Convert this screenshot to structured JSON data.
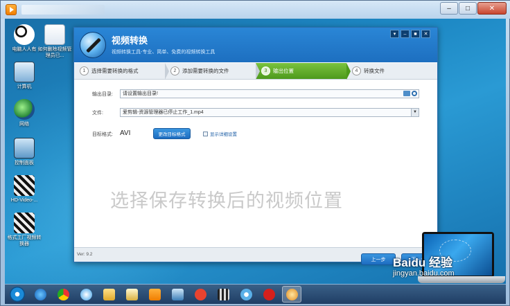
{
  "desktop_icons": [
    {
      "label": "电脑人人有",
      "glyph": "panda-icon"
    },
    {
      "label": "如何删除视频管理员已...",
      "glyph": "document-icon"
    },
    {
      "label": "计算机",
      "glyph": "computer-icon"
    },
    {
      "label": "网络",
      "glyph": "network-icon"
    },
    {
      "label": "控制面板",
      "glyph": "control-panel-icon"
    },
    {
      "label": "HD-Video-...",
      "glyph": "clapper-icon"
    },
    {
      "label": "格式工厂视频转换器",
      "glyph": "clapper-icon"
    }
  ],
  "app": {
    "title": "视频转换",
    "subtitle": "视频转换工具-专业、简单、免费的视频转换工具",
    "window_controls": [
      "▾",
      "–",
      "■",
      "✕"
    ],
    "steps": [
      {
        "num": "1",
        "label": "选择需要转换的格式",
        "active": false
      },
      {
        "num": "2",
        "label": "添加需要转换的文件",
        "active": false
      },
      {
        "num": "3",
        "label": "输出位置",
        "active": true
      },
      {
        "num": "4",
        "label": "转换文件",
        "active": false
      }
    ],
    "output_dir": {
      "label": "输出目录:",
      "value": "请设置输出目录!"
    },
    "file": {
      "label": "文件:",
      "value": "爱剪辑-资源管理器已停止工作_1.mp4"
    },
    "target_format": {
      "label": "目标格式:",
      "value": "AVI",
      "change_button": "更改目标格式",
      "details_checkbox": "显示详细设置"
    },
    "watermark_text": "选择保存转换后的视频位置",
    "version": "Ver: 9.2",
    "prev_button": "上一步",
    "next_button": "下一步"
  },
  "baidu": {
    "text": "Baidu 经验",
    "url": "jingyan.baidu.com"
  },
  "taskbar_icons": [
    "start-orb-icon",
    "ie-icon",
    "chrome-icon",
    "cloud-icon",
    "folder-icon",
    "explorer-icon",
    "media-icon",
    "screen-icon",
    "wps-icon",
    "film-icon",
    "flower-icon",
    "red-app-icon",
    "app-icon"
  ],
  "colors": {
    "accent": "#1d6fc0",
    "step_active": "#5aa52a",
    "desktop": "#1d88c4"
  }
}
